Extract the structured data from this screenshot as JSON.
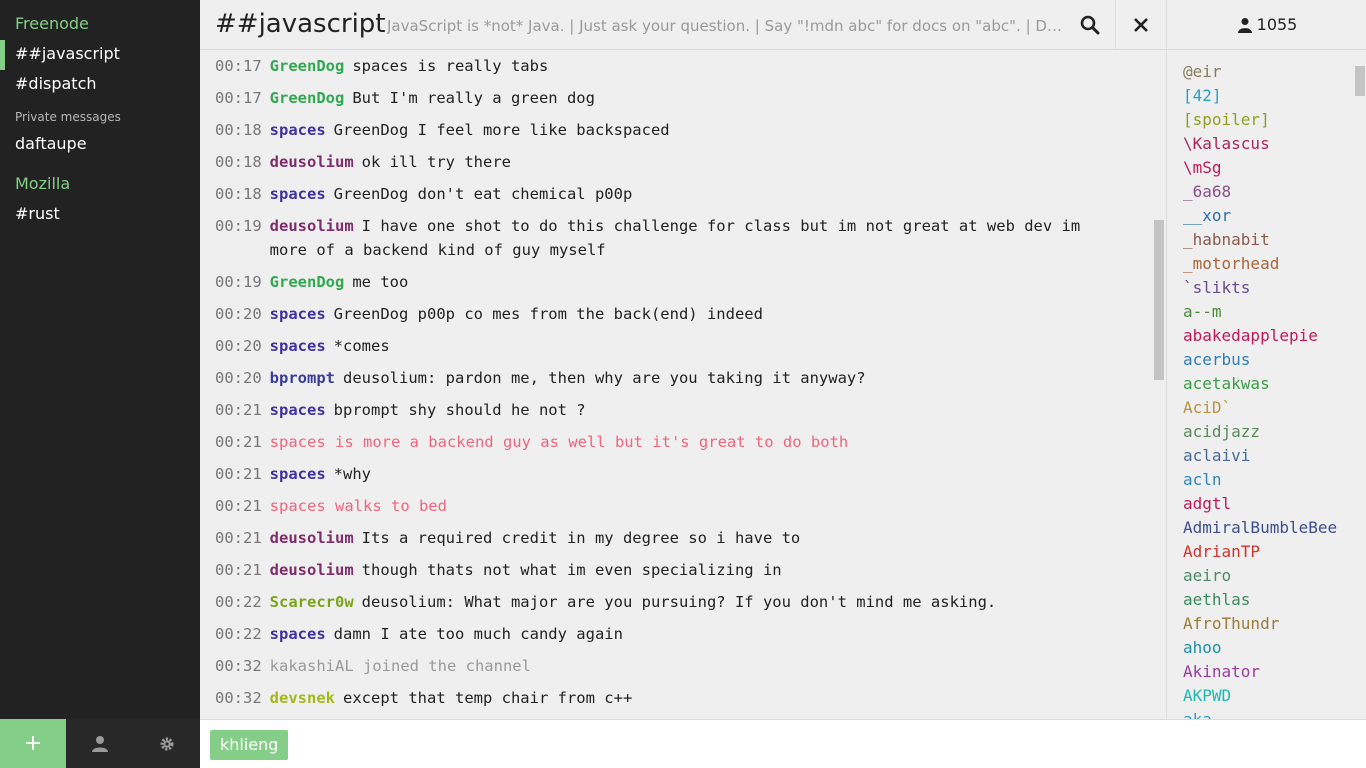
{
  "sidebar": {
    "networks": [
      {
        "name": "Freenode",
        "items": [
          "##javascript",
          "#dispatch"
        ],
        "private_label": "Private messages",
        "private": [
          "daftaupe"
        ]
      },
      {
        "name": "Mozilla",
        "items": [
          "#rust"
        ]
      }
    ],
    "footer": {
      "add": "+"
    }
  },
  "header": {
    "channel": "##javascript",
    "topic": "JavaScript is *not* Java. | Just ask your question. | Say \"!mdn abc\" for docs on \"abc\". | Don't paste code in the channel."
  },
  "userlist": {
    "count": "1055",
    "users": [
      {
        "name": "@eir",
        "color": "#8a7b5a"
      },
      {
        "name": "[42]",
        "color": "#2aa0c8"
      },
      {
        "name": "[spoiler]",
        "color": "#8fa020"
      },
      {
        "name": "\\Kalascus",
        "color": "#a8275e"
      },
      {
        "name": "\\mSg",
        "color": "#c2185b"
      },
      {
        "name": "_6a68",
        "color": "#8a4f8a"
      },
      {
        "name": "__xor",
        "color": "#2e6fa8"
      },
      {
        "name": "_habnabit",
        "color": "#8b5a4a"
      },
      {
        "name": "_motorhead",
        "color": "#a8643c"
      },
      {
        "name": "`slikts",
        "color": "#6a4c8c"
      },
      {
        "name": "a--m",
        "color": "#4b8b3b"
      },
      {
        "name": "abakedapplepie",
        "color": "#c2185b"
      },
      {
        "name": "acerbus",
        "color": "#2e7db8"
      },
      {
        "name": "acetakwas",
        "color": "#3a9d45"
      },
      {
        "name": "AciD`",
        "color": "#b8924a"
      },
      {
        "name": "acidjazz",
        "color": "#5a8a5a"
      },
      {
        "name": "aclaivi",
        "color": "#4a6a9a"
      },
      {
        "name": "acln",
        "color": "#2e86c1"
      },
      {
        "name": "adgtl",
        "color": "#c2185b"
      },
      {
        "name": "AdmiralBumbleBee",
        "color": "#3d4f8c"
      },
      {
        "name": "AdrianTP",
        "color": "#d0342c"
      },
      {
        "name": "aeiro",
        "color": "#4b8b6b"
      },
      {
        "name": "aethlas",
        "color": "#3a8b5b"
      },
      {
        "name": "AfroThundr",
        "color": "#9a7b3a"
      },
      {
        "name": "ahoo",
        "color": "#1f8fa0"
      },
      {
        "name": "Akinator",
        "color": "#9a3aa0"
      },
      {
        "name": "AKPWD",
        "color": "#1fb7b0"
      },
      {
        "name": "aka",
        "color": "#2aa0c8"
      }
    ]
  },
  "messages": [
    {
      "time": "00:17",
      "nick": "GreenDog",
      "nick_color": "#32a852",
      "text": "spaces is really tabs",
      "type": "normal"
    },
    {
      "time": "00:17",
      "nick": "GreenDog",
      "nick_color": "#32a852",
      "text": "But I'm really a green dog",
      "type": "normal"
    },
    {
      "time": "00:18",
      "nick": "spaces",
      "nick_color": "#3f31a0",
      "text": "GreenDog I feel more like backspaced",
      "type": "normal"
    },
    {
      "time": "00:18",
      "nick": "deusolium",
      "nick_color": "#7d2d6b",
      "text": "ok ill try there",
      "type": "normal"
    },
    {
      "time": "00:18",
      "nick": "spaces",
      "nick_color": "#3f31a0",
      "text": "GreenDog don't eat chemical p00p",
      "type": "normal"
    },
    {
      "time": "00:19",
      "nick": "deusolium",
      "nick_color": "#7d2d6b",
      "text": "I have one shot to do this challenge for class but im not great at web dev im more of a backend kind of guy myself",
      "type": "normal"
    },
    {
      "time": "00:19",
      "nick": "GreenDog",
      "nick_color": "#32a852",
      "text": "me too",
      "type": "normal"
    },
    {
      "time": "00:20",
      "nick": "spaces",
      "nick_color": "#3f31a0",
      "text": "GreenDog p00p co mes from the back(end) indeed",
      "type": "normal"
    },
    {
      "time": "00:20",
      "nick": "spaces",
      "nick_color": "#3f31a0",
      "text": "*comes",
      "type": "normal"
    },
    {
      "time": "00:20",
      "nick": "bprompt",
      "nick_color": "#3b3b9e",
      "text": "deusolium: pardon me, then why are you taking it anyway?",
      "type": "normal"
    },
    {
      "time": "00:21",
      "nick": "spaces",
      "nick_color": "#3f31a0",
      "text": "bprompt shy should he not ?",
      "type": "normal"
    },
    {
      "time": "00:21",
      "nick": "",
      "nick_color": "",
      "text": "spaces is more a backend guy as well but it's great to do both",
      "type": "action"
    },
    {
      "time": "00:21",
      "nick": "spaces",
      "nick_color": "#3f31a0",
      "text": "*why",
      "type": "normal"
    },
    {
      "time": "00:21",
      "nick": "",
      "nick_color": "",
      "text": "spaces walks to bed",
      "type": "action"
    },
    {
      "time": "00:21",
      "nick": "deusolium",
      "nick_color": "#7d2d6b",
      "text": "Its a required credit in my degree so i have to",
      "type": "normal"
    },
    {
      "time": "00:21",
      "nick": "deusolium",
      "nick_color": "#7d2d6b",
      "text": "though thats not what im even specializing in",
      "type": "normal"
    },
    {
      "time": "00:22",
      "nick": "Scarecr0w",
      "nick_color": "#7aa51a",
      "text": "deusolium: What major are you pursuing? If you don't mind me asking.",
      "type": "normal"
    },
    {
      "time": "00:22",
      "nick": "spaces",
      "nick_color": "#3f31a0",
      "text": "damn I ate too much candy again",
      "type": "normal"
    },
    {
      "time": "00:32",
      "nick": "",
      "nick_color": "",
      "text": "kakashiAL joined the channel",
      "type": "join"
    },
    {
      "time": "00:32",
      "nick": "devsnek",
      "nick_color": "#a5b81a",
      "text": "except that temp chair from c++",
      "type": "normal"
    }
  ],
  "input": {
    "nick": "khlieng",
    "placeholder": ""
  },
  "colors": {
    "accent": "#84ce88",
    "sidebar_bg": "#222222",
    "action": "#f0657b"
  }
}
